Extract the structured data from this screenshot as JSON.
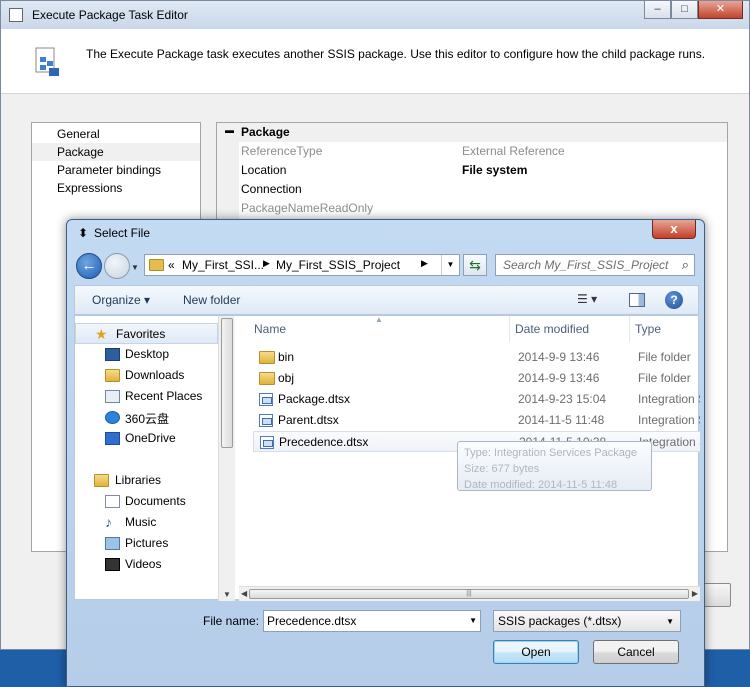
{
  "editor": {
    "title": "Execute Package Task Editor",
    "description": "The Execute Package task executes another SSIS package. Use this editor to configure how the child package runs.",
    "nav": [
      "General",
      "Package",
      "Parameter bindings",
      "Expressions"
    ],
    "nav_selected": "Package",
    "propgrid": {
      "category": "Package",
      "rows": [
        {
          "key": "ReferenceType",
          "value": "External Reference",
          "dim": true
        },
        {
          "key": "Location",
          "value": "File system",
          "dim": false,
          "bold_value": true
        },
        {
          "key": "Connection",
          "value": "",
          "dim": false
        },
        {
          "key": "PackageNameReadOnly",
          "value": "",
          "dim": true
        }
      ]
    }
  },
  "dialog": {
    "title": "Select File",
    "close_label": "x",
    "address": {
      "overflow": "«",
      "crumbs": [
        "My_First_SSI...",
        "My_First_SSIS_Project"
      ]
    },
    "search_placeholder": "Search My_First_SSIS_Project",
    "toolbar": {
      "organize": "Organize ▾",
      "new_folder": "New folder"
    },
    "nav_pane": [
      {
        "label": "Favorites",
        "icon": "star-icon",
        "header": true
      },
      {
        "label": "Desktop",
        "icon": "desktop-icon"
      },
      {
        "label": "Downloads",
        "icon": "downloads-icon"
      },
      {
        "label": "Recent Places",
        "icon": "recent-places-icon"
      },
      {
        "label": "360云盘",
        "icon": "cloud-disk-icon"
      },
      {
        "label": "OneDrive",
        "icon": "onedrive-icon"
      },
      {
        "label": "Libraries",
        "icon": "libraries-icon",
        "header": true
      },
      {
        "label": "Documents",
        "icon": "documents-icon"
      },
      {
        "label": "Music",
        "icon": "music-icon"
      },
      {
        "label": "Pictures",
        "icon": "pictures-icon"
      },
      {
        "label": "Videos",
        "icon": "videos-icon"
      }
    ],
    "columns": {
      "name": "Name",
      "date": "Date modified",
      "type": "Type"
    },
    "files": [
      {
        "name": "bin",
        "date": "2014-9-9 13:46",
        "type": "File folder",
        "kind": "folder"
      },
      {
        "name": "obj",
        "date": "2014-9-9 13:46",
        "type": "File folder",
        "kind": "folder"
      },
      {
        "name": "Package.dtsx",
        "date": "2014-9-23 15:04",
        "type": "Integration S",
        "kind": "dtsx"
      },
      {
        "name": "Parent.dtsx",
        "date": "2014-11-5 11:48",
        "type": "Integration S",
        "kind": "dtsx"
      },
      {
        "name": "Precedence.dtsx",
        "date": "2014-11-5 10:38",
        "type": "Integration S",
        "kind": "dtsx",
        "selected": true
      }
    ],
    "tooltip": {
      "type": "Type: Integration Services Package",
      "size": "Size: 677 bytes",
      "modified": "Date modified: 2014-11-5 11:48"
    },
    "filename_label": "File name:",
    "filename_value": "Precedence.dtsx",
    "filetype_value": "SSIS packages (*.dtsx)",
    "open_label": "Open",
    "cancel_label": "Cancel"
  }
}
